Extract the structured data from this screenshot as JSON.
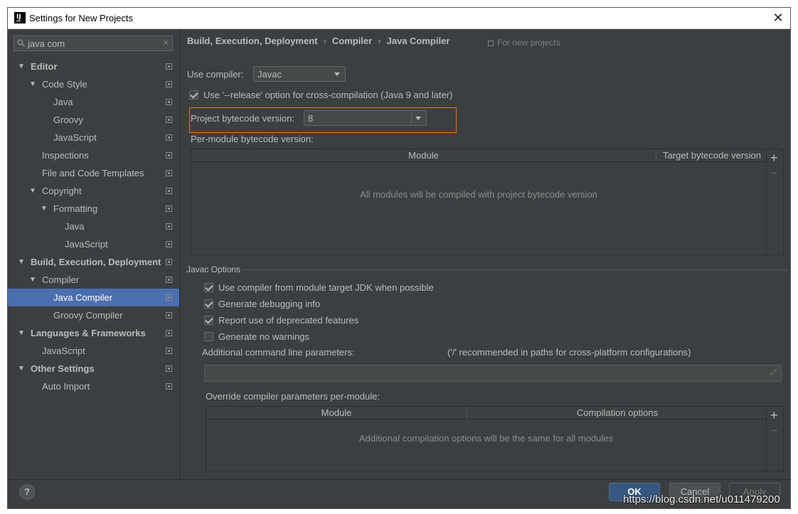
{
  "window": {
    "title": "Settings for New Projects"
  },
  "search": {
    "value": "java com"
  },
  "tree": [
    {
      "label": "Editor",
      "arrow": "▼"
    },
    {
      "label": "Code Style",
      "arrow": "▼"
    },
    {
      "label": "Java",
      "arrow": ""
    },
    {
      "label": "Groovy",
      "arrow": ""
    },
    {
      "label": "JavaScript",
      "arrow": ""
    },
    {
      "label": "Inspections",
      "arrow": ""
    },
    {
      "label": "File and Code Templates",
      "arrow": ""
    },
    {
      "label": "Copyright",
      "arrow": "▼"
    },
    {
      "label": "Formatting",
      "arrow": "▼"
    },
    {
      "label": "Java",
      "arrow": ""
    },
    {
      "label": "JavaScript",
      "arrow": ""
    },
    {
      "label": "Build, Execution, Deployment",
      "arrow": "▼"
    },
    {
      "label": "Compiler",
      "arrow": "▼"
    },
    {
      "label": "Java Compiler",
      "arrow": ""
    },
    {
      "label": "Groovy Compiler",
      "arrow": ""
    },
    {
      "label": "Languages & Frameworks",
      "arrow": "▼"
    },
    {
      "label": "JavaScript",
      "arrow": ""
    },
    {
      "label": "Other Settings",
      "arrow": "▼"
    },
    {
      "label": "Auto Import",
      "arrow": ""
    }
  ],
  "breadcrumb": {
    "part1": "Build, Execution, Deployment",
    "part2": "Compiler",
    "part3": "Java Compiler",
    "sep": "›"
  },
  "for_new_projects": "For new projects",
  "compiler": {
    "use_compiler_label": "Use compiler:",
    "use_compiler_value": "Javac",
    "release_option": "Use '--release' option for cross-compilation (Java 9 and later)",
    "bytecode_label": "Project bytecode version:",
    "bytecode_value": "8",
    "per_module_label": "Per-module bytecode version:",
    "module_col": "Module",
    "target_col": "Target bytecode version",
    "module_empty": "All modules will be compiled with project bytecode version"
  },
  "javac": {
    "section_title": "Javac Options",
    "opt1": "Use compiler from module target JDK when possible",
    "opt2": "Generate debugging info",
    "opt3": "Report use of deprecated features",
    "opt4": "Generate no warnings",
    "params_label": "Additional command line parameters:",
    "params_hint": "('/' recommended in paths for cross-platform configurations)",
    "params_value": "",
    "override_label": "Override compiler parameters per-module:",
    "override_module_col": "Module",
    "override_options_col": "Compilation options",
    "override_empty": "Additional compilation options will be the same for all modules"
  },
  "footer": {
    "help": "?",
    "ok": "OK",
    "cancel": "Cancel",
    "apply": "Apply"
  },
  "watermark": "https://blog.csdn.net/u011479200",
  "colors": {
    "background": "#3c3f41",
    "selection": "#4b6eaf",
    "highlight_border": "#e07a21",
    "ok_button": "#365880"
  }
}
